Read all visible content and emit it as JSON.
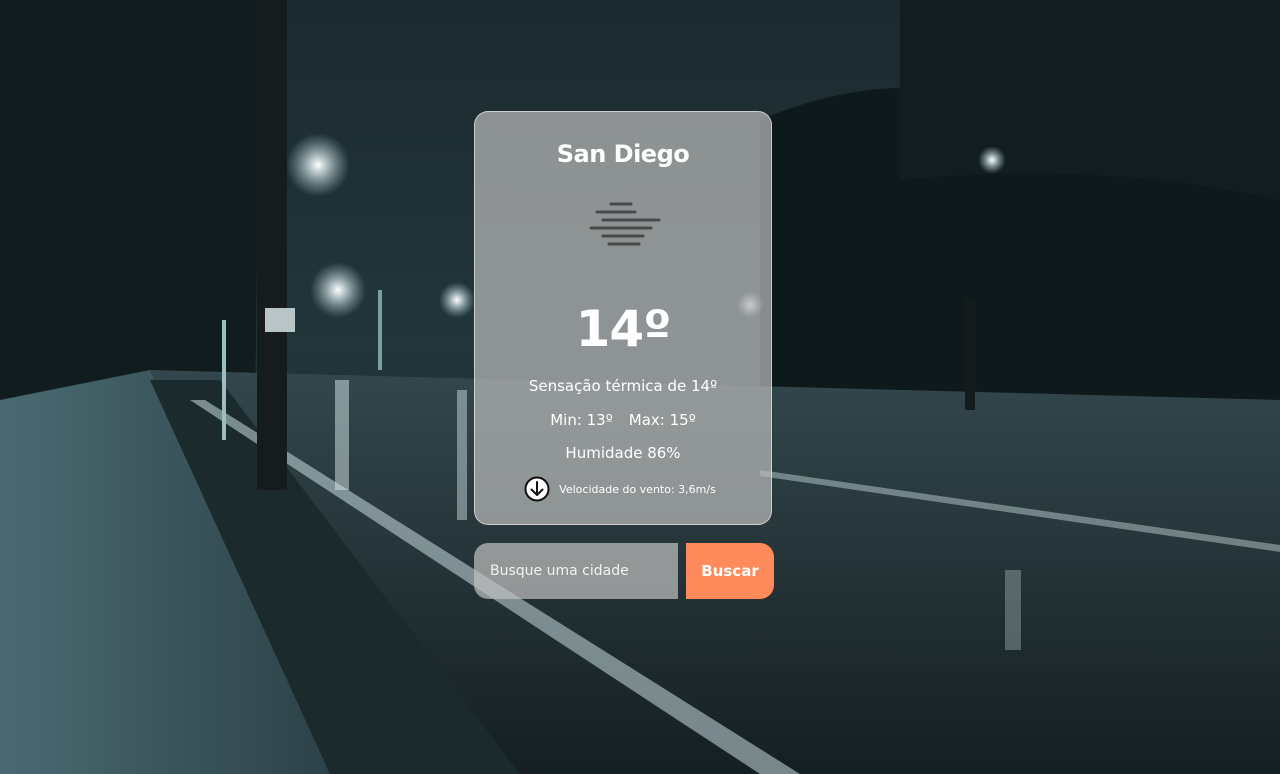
{
  "weather": {
    "city": "San Diego",
    "icon": "fog-icon",
    "temperature": "14º",
    "feels_like": "Sensação térmica de 14º",
    "min": "Min: 13º",
    "max": "Max: 15º",
    "humidity": "Humidade 86%",
    "wind_icon": "arrow-down-circle-icon",
    "wind": "Velocidade do vento: 3,6m/s"
  },
  "search": {
    "placeholder": "Busque uma cidade",
    "value": "",
    "button_label": "Buscar"
  },
  "colors": {
    "accent": "#ff8a5b",
    "card_bg": "#b9b9b9",
    "text": "#ffffff"
  }
}
